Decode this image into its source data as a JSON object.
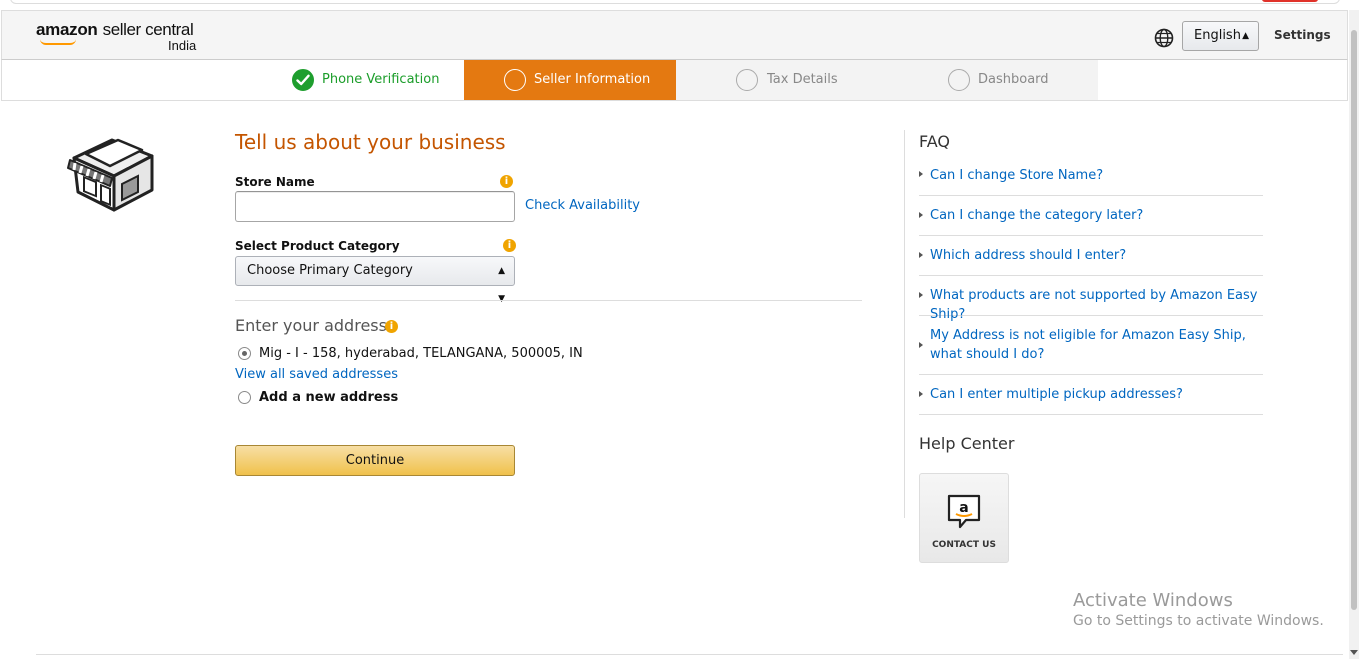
{
  "header": {
    "logo_brand": "amazon",
    "logo_product": "seller central",
    "logo_region": "India",
    "language": "English",
    "settings_label": "Settings"
  },
  "steps": [
    {
      "label": "Phone Verification",
      "state": "completed"
    },
    {
      "label": "Seller Information",
      "state": "active"
    },
    {
      "label": "Tax Details",
      "state": "pending"
    },
    {
      "label": "Dashboard",
      "state": "pending"
    }
  ],
  "form": {
    "title": "Tell us about your business",
    "store_name_label": "Store Name",
    "store_name_value": "",
    "check_availability": "Check Availability",
    "category_label": "Select Product Category",
    "category_value": "Choose Primary Category",
    "address_heading": "Enter your address",
    "saved_address": "Mig - I - 158, hyderabad, TELANGANA, 500005, IN",
    "view_saved": "View all saved addresses",
    "add_new": "Add a new address",
    "continue_label": "Continue"
  },
  "faq": {
    "title": "FAQ",
    "items": [
      "Can I change Store Name?",
      "Can I change the category later?",
      "Which address should I enter?",
      "What products are not supported by Amazon Easy Ship?",
      "My Address is not eligible for Amazon Easy Ship, what should I do?",
      "Can I enter multiple pickup addresses?"
    ]
  },
  "help": {
    "title": "Help Center",
    "contact_label": "CONTACT US"
  },
  "watermark": {
    "line1": "Activate Windows",
    "line2": "Go to Settings to activate Windows."
  },
  "colors": {
    "accent_orange": "#e47911",
    "title_orange": "#c45500",
    "link_blue": "#0066c0",
    "success_green": "#1e9e2e",
    "button_yellow": "#f0c14b"
  }
}
